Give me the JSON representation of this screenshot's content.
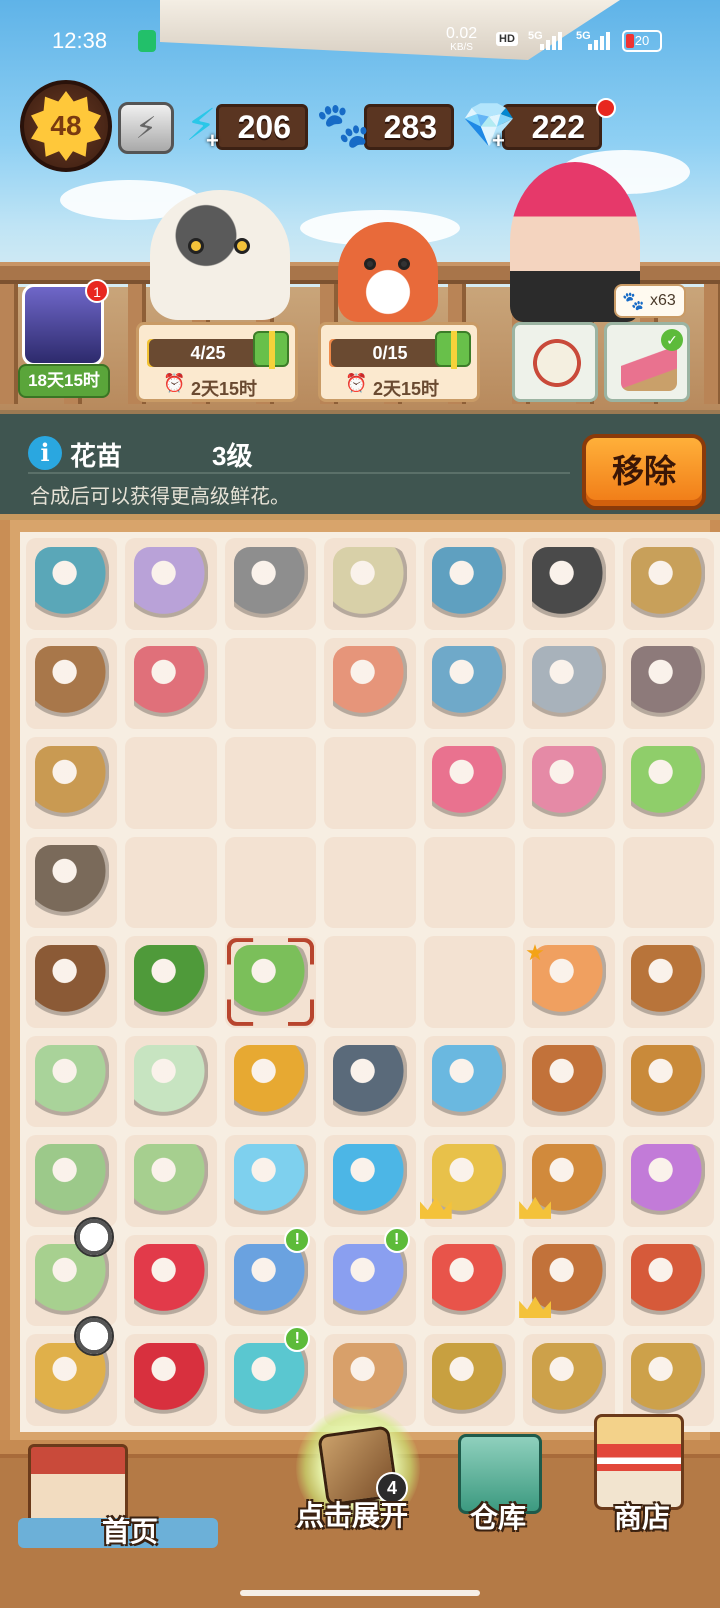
{
  "status_bar": {
    "time": "12:38",
    "speed_value": "0.02",
    "speed_unit": "KB/S",
    "hd_label": "HD",
    "sim1": "5G",
    "sim2": "5G",
    "battery": "20"
  },
  "hud": {
    "level": "48",
    "energy": "206",
    "paws": "283",
    "gems": "222",
    "icons": [
      "bolt-icon",
      "energy-icon",
      "paw-icon",
      "gem-icon"
    ]
  },
  "event": {
    "portrait_badge": "1",
    "timer": "18天15时"
  },
  "tasks": [
    {
      "progress": "4/25",
      "time_left": "2天15时"
    },
    {
      "progress": "0/15",
      "time_left": "2天15时"
    }
  ],
  "order": {
    "count": "x63"
  },
  "info": {
    "name": "花苗",
    "level": "3级",
    "description": "合成后可以获得更高级鲜花。",
    "remove_label": "移除"
  },
  "board": {
    "rows": [
      [
        "bucket",
        "vending-machine",
        "rake",
        "tin-can",
        "drying-rack",
        "grill",
        "straw-hut"
      ],
      [
        "wash-tub",
        "claw-machine",
        "",
        "paper-roll",
        "drying-rack-small",
        "grill-stand",
        "glove"
      ],
      [
        "wooden-tub",
        "",
        "",
        "",
        "pink-broom",
        "dustpan",
        "soap"
      ],
      [
        "fishing-rod-small",
        "",
        "",
        "",
        "",
        "",
        ""
      ],
      [
        "fishing-rod",
        "potted-flower",
        "sprout-pot",
        "",
        "",
        "fox-sticker",
        "rope-short"
      ],
      [
        "vase-small",
        "glass-jar",
        "paw-cookies",
        "battery-small",
        "battery",
        "rope-piece",
        "rope-coil"
      ],
      [
        "pouch-vase",
        "green-vase",
        "crystal",
        "crystals",
        "battery-pack",
        "sewing-box",
        "slinky"
      ],
      [
        "ribbon-vase",
        "rose-heart",
        "gift-blue",
        "gift-purple",
        "cards",
        "coiled-rope",
        "seedling"
      ],
      [
        "flower-vase",
        "rose-heart-small",
        "gift-teal",
        "photo-album",
        "handbag",
        "basket-tools",
        "basket-tools"
      ]
    ],
    "selected": [
      4,
      2
    ],
    "excl_badges": [
      [
        7,
        2
      ],
      [
        7,
        3
      ],
      [
        8,
        2
      ]
    ],
    "crowns": [
      [
        6,
        4
      ],
      [
        6,
        5
      ],
      [
        7,
        5
      ]
    ],
    "stopwatches": [
      [
        7,
        0
      ],
      [
        8,
        0
      ]
    ],
    "stars": [
      [
        4,
        5
      ]
    ],
    "colors": {
      "bucket": "#5aa7b8",
      "vending-machine": "#b9a2d8",
      "rake": "#8e8e8e",
      "tin-can": "#d8d0a8",
      "drying-rack": "#5fa0c0",
      "grill": "#4a4a4a",
      "straw-hut": "#c8a05a",
      "wash-tub": "#a8774a",
      "claw-machine": "#e0707a",
      "paper-roll": "#e6957a",
      "drying-rack-small": "#6fa9c9",
      "grill-stand": "#a8b2bb",
      "glove": "#8d7a7a",
      "wooden-tub": "#c99a52",
      "pink-broom": "#e9728f",
      "dustpan": "#e58aa6",
      "soap": "#8fce6a",
      "fishing-rod-small": "#7a6a5a",
      "fishing-rod": "#8b5a36",
      "potted-flower": "#4f9a3a",
      "sprout-pot": "#7bbf5a",
      "fox-sticker": "#f0a060",
      "rope-short": "#b8743a",
      "vase-small": "#a9d39a",
      "glass-jar": "#c7e4c1",
      "paw-cookies": "#e7a932",
      "battery-small": "#5a6a7a",
      "battery": "#6ab8e0",
      "rope-piece": "#c2723a",
      "rope-coil": "#c98a3a",
      "pouch-vase": "#9cc98a",
      "green-vase": "#a6cf8f",
      "crystal": "#7ed0ee",
      "crystals": "#4cb6e6",
      "battery-pack": "#e8c14a",
      "sewing-box": "#d18a3c",
      "slinky": "#c27bd8",
      "ribbon-vase": "#a7d08f",
      "rose-heart": "#e23a4a",
      "gift-blue": "#6aa2e0",
      "gift-purple": "#8a9ff0",
      "cards": "#e8544a",
      "coiled-rope": "#c2723a",
      "seedling": "#d65a3a",
      "flower-vase": "#e0b04a",
      "rose-heart-small": "#d8303e",
      "gift-teal": "#5ac7d0",
      "photo-album": "#d8a06a",
      "handbag": "#c8a040",
      "basket-tools": "#cda14a"
    }
  },
  "nav": {
    "home": "首页",
    "expand": "点击展开",
    "expand_count": "4",
    "warehouse": "仓库",
    "shop": "商店"
  }
}
